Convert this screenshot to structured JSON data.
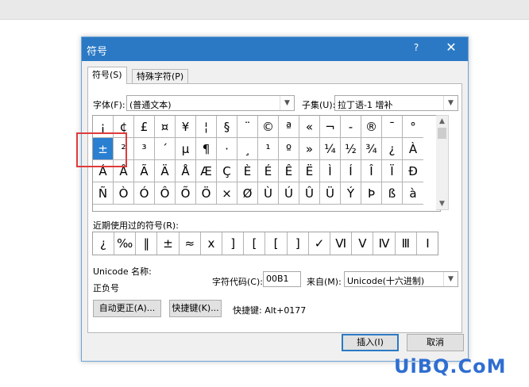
{
  "dialog": {
    "title": "符号",
    "help": "?",
    "close": "✕",
    "tabs": [
      "符号(S)",
      "特殊字符(P)"
    ],
    "font_label": "字体(F):",
    "font_value": "(普通文本)",
    "subset_label": "子集(U):",
    "subset_value": "拉丁语-1 增补",
    "symbol_rows": [
      [
        "¡",
        "¢",
        "£",
        "¤",
        "¥",
        "¦",
        "§",
        "¨",
        "©",
        "ª",
        "«",
        "¬",
        "-",
        "®",
        "¯",
        "°"
      ],
      [
        "±",
        "²",
        "³",
        "´",
        "µ",
        "¶",
        "·",
        "¸",
        "¹",
        "º",
        "»",
        "¼",
        "½",
        "¾",
        "¿",
        "À"
      ],
      [
        "Á",
        "Â",
        "Ã",
        "Ä",
        "Å",
        "Æ",
        "Ç",
        "È",
        "É",
        "Ê",
        "Ë",
        "Ì",
        "Í",
        "Î",
        "Ï",
        "Ð"
      ],
      [
        "Ñ",
        "Ò",
        "Ó",
        "Ô",
        "Õ",
        "Ö",
        "×",
        "Ø",
        "Ù",
        "Ú",
        "Û",
        "Ü",
        "Ý",
        "Þ",
        "ß",
        "à"
      ]
    ],
    "selected_symbol": "±",
    "recent_label": "近期使用过的符号(R):",
    "recent_symbols": [
      "¿",
      "‰",
      "‖",
      "±",
      "≈",
      "x",
      "]",
      "[",
      "[",
      "]",
      "✓",
      "Ⅵ",
      "Ⅴ",
      "Ⅳ",
      "Ⅲ",
      "Ⅰ"
    ],
    "unicode_name_label": "Unicode 名称:",
    "unicode_name": "正负号",
    "char_code_label": "字符代码(C):",
    "char_code": "00B1",
    "from_label": "来自(M):",
    "from_value": "Unicode(十六进制)",
    "autocorrect_button": "自动更正(A)...",
    "shortcut_button": "快捷键(K)...",
    "shortcut_text": "快捷键: Alt+0177",
    "insert_button": "插入(I)",
    "cancel_button": "取消"
  },
  "watermark": "UiBQ.CoM",
  "colors": {
    "titlebar": "#2b79c4",
    "selection": "#2a7fd1",
    "highlight_box": "#e03a3a",
    "watermark": "#2f6ed1"
  }
}
